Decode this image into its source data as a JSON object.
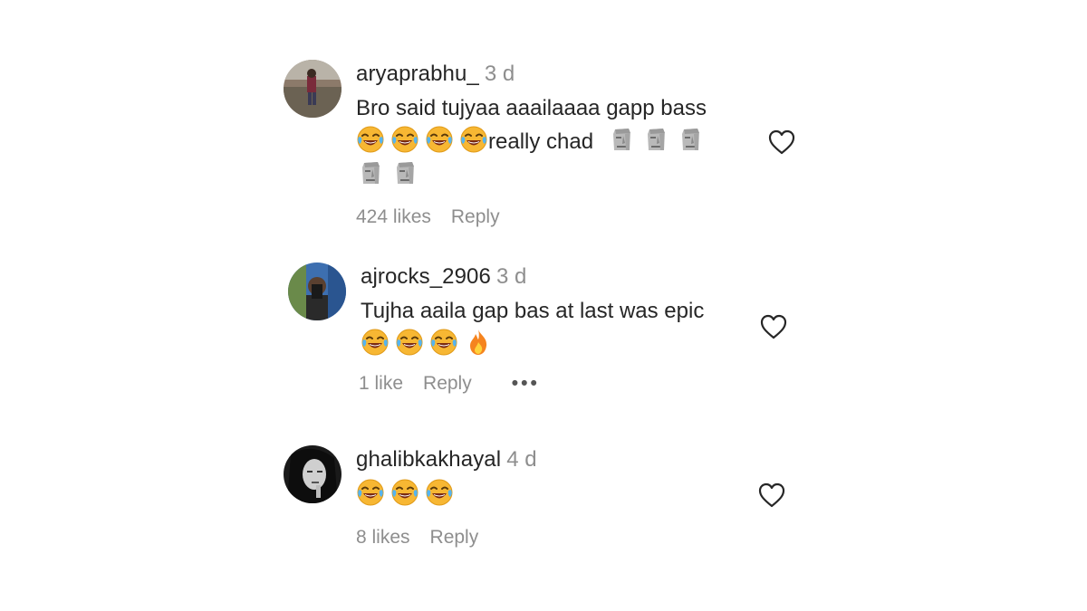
{
  "comments": [
    {
      "username": "aryaprabhu_",
      "time": "3 d",
      "text_line1": "Bro said tujyaa aaailaaaa gapp bass",
      "text_line2_suffix": "really chad",
      "likes": "424 likes",
      "reply": "Reply"
    },
    {
      "username": "ajrocks_2906",
      "time": "3 d",
      "text_line1": "Tujha aaila gap bas at last was epic",
      "likes": "1 like",
      "reply": "Reply",
      "more": "•••"
    },
    {
      "username": "ghalibkakhayal",
      "time": "4 d",
      "likes": "8 likes",
      "reply": "Reply"
    }
  ],
  "icons": {
    "laugh": "face-with-tears-of-joy-icon",
    "moai": "moai-icon",
    "fire": "fire-icon",
    "heart": "heart-outline-icon",
    "more": "more-options-icon"
  },
  "colors": {
    "text": "#262626",
    "secondary": "#8e8e8e"
  }
}
